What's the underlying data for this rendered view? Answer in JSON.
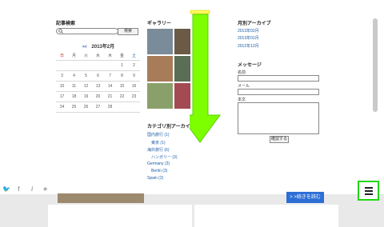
{
  "sidebar": {
    "search": {
      "title": "記事検索",
      "button": "検索",
      "placeholder": ""
    },
    "calendar": {
      "prev": "<<",
      "month": "2013年2月",
      "weekdays": [
        "日",
        "月",
        "火",
        "水",
        "木",
        "金",
        "土"
      ],
      "weeks": [
        [
          "",
          "",
          "",
          "",
          "",
          "1",
          "2"
        ],
        [
          "3",
          "4",
          "5",
          "6",
          "7",
          "8",
          "9"
        ],
        [
          "10",
          "11",
          "12",
          "13",
          "14",
          "15",
          "16"
        ],
        [
          "17",
          "18",
          "19",
          "20",
          "21",
          "22",
          "23"
        ],
        [
          "24",
          "25",
          "26",
          "27",
          "28",
          "",
          ""
        ]
      ]
    },
    "gallery": {
      "title": "ギャラリー"
    },
    "category_archive": {
      "title": "カテゴリ別アーカイブ",
      "items": [
        "国内旅行 (1)",
        "東京 (1)",
        "海外旅行 (6)",
        "ハンガリー (3)",
        "Germany (3)",
        "Berlin (3)",
        "Spain (2)"
      ]
    },
    "monthly_archive": {
      "title": "月別アーカイブ",
      "items": [
        "2013年02月",
        "2013年01月",
        "2012年12月"
      ]
    },
    "message": {
      "title": "メッセージ",
      "name_label": "名前",
      "mail_label": "メール",
      "body_label": "本文",
      "confirm_button": "確認する"
    }
  },
  "social": {
    "icons": [
      "twitter-icon",
      "facebook-icon",
      "info-icon",
      "star-icon"
    ],
    "twitter": "🐦",
    "facebook": "f",
    "info": "i",
    "star": "★"
  },
  "readmore": "> >続きを読む",
  "colors": {
    "highlight": "#22d60f",
    "arrow": "#7dff00",
    "link": "#1a5ca8",
    "button": "#2c6ed5"
  }
}
